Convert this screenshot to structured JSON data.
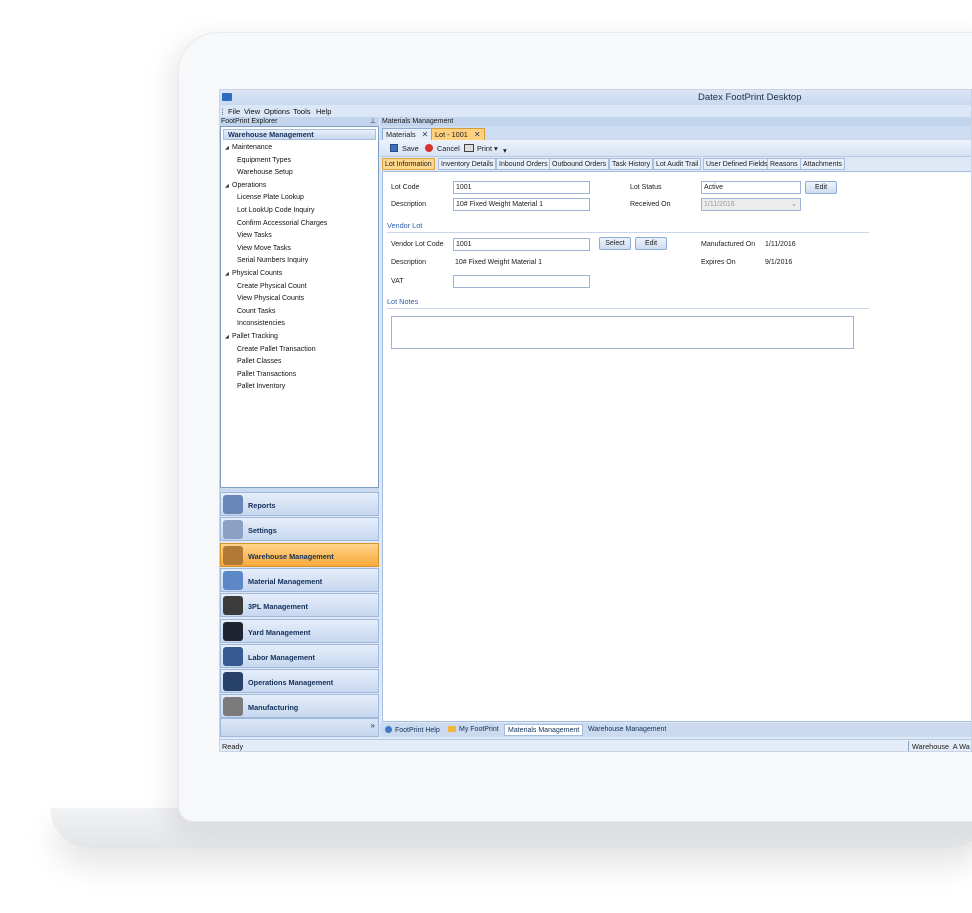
{
  "app": {
    "title": "Datex FootPrint Desktop"
  },
  "menu": [
    "File",
    "View",
    "Options",
    "Tools",
    "Help"
  ],
  "explorer": {
    "header": "FootPrint Explorer",
    "section": "Warehouse Management",
    "tree": [
      {
        "label": "Maintenance",
        "group": true
      },
      {
        "label": "Equipment Types"
      },
      {
        "label": "Warehouse Setup"
      },
      {
        "label": "Operations",
        "group": true
      },
      {
        "label": "License Plate Lookup"
      },
      {
        "label": "Lot LookUp Code Inquiry"
      },
      {
        "label": "Confirm Accessorial Charges"
      },
      {
        "label": "View Tasks"
      },
      {
        "label": "View Move Tasks"
      },
      {
        "label": "Serial Numbers Inquiry"
      },
      {
        "label": "Physical Counts",
        "group": true
      },
      {
        "label": "Create Physical Count"
      },
      {
        "label": "View Physical Counts"
      },
      {
        "label": "Count Tasks"
      },
      {
        "label": "Inconsistencies"
      },
      {
        "label": "Pallet Tracking",
        "group": true
      },
      {
        "label": "Create Pallet Transaction"
      },
      {
        "label": "Pallet Classes"
      },
      {
        "label": "Pallet Transactions"
      },
      {
        "label": "Pallet Inventory"
      }
    ]
  },
  "nav": [
    {
      "label": "Reports",
      "icon": "reports-icon",
      "color": "#6a86b8"
    },
    {
      "label": "Settings",
      "icon": "settings-icon",
      "color": "#8aa1c4"
    },
    {
      "label": "Warehouse Management",
      "icon": "warehouse-icon",
      "color": "#b07a36",
      "active": true
    },
    {
      "label": "Material Management",
      "icon": "material-icon",
      "color": "#5d88c7"
    },
    {
      "label": "3PL Management",
      "icon": "3pl-icon",
      "color": "#3b3b3b"
    },
    {
      "label": "Yard Management",
      "icon": "yard-icon",
      "color": "#1f2430"
    },
    {
      "label": "Labor Management",
      "icon": "labor-icon",
      "color": "#365b91"
    },
    {
      "label": "Operations Management",
      "icon": "operations-icon",
      "color": "#27416b"
    },
    {
      "label": "Manufacturing",
      "icon": "manufacturing-icon",
      "color": "#7b7b7b"
    }
  ],
  "main": {
    "header": "Materials Management",
    "doc_tabs": [
      {
        "label": "Materials"
      },
      {
        "label": "Lot - 1001",
        "active": true
      }
    ],
    "toolbar": {
      "save": "Save",
      "cancel": "Cancel",
      "print": "Print"
    },
    "subtabs": [
      {
        "label": "Lot Information",
        "active": true
      },
      {
        "label": "Inventory Details"
      },
      {
        "label": "Inbound Orders"
      },
      {
        "label": "Outbound Orders"
      },
      {
        "label": "Task History"
      },
      {
        "label": "Lot Audit Trail"
      },
      {
        "label": "User Defined Fields"
      },
      {
        "label": "Reasons"
      },
      {
        "label": "Attachments"
      }
    ],
    "form": {
      "lot_code_label": "Lot Code",
      "lot_code": "1001",
      "description_label": "Description",
      "description": "10# Fixed Weight Material 1",
      "lot_status_label": "Lot Status",
      "lot_status": "Active",
      "edit": "Edit",
      "received_on_label": "Received On",
      "received_on": "1/11/2016",
      "vendor_lot_section": "Vendor Lot",
      "vendor_lot_code_label": "Vendor Lot Code",
      "vendor_lot_code": "1001",
      "select": "Select",
      "vendor_description_label": "Description",
      "vendor_description": "10# Fixed Weight Material 1",
      "vat_label": "VAT",
      "vat": "",
      "manufactured_on_label": "Manufactured On",
      "manufactured_on": "1/11/2016",
      "expires_on_label": "Expires On",
      "expires_on": "9/1/2016",
      "lot_notes_section": "Lot Notes"
    },
    "bottom_tabs": [
      {
        "label": "FootPrint Help"
      },
      {
        "label": "My FootPrint"
      },
      {
        "label": "Materials Management",
        "active": true
      },
      {
        "label": "Warehouse Management"
      }
    ]
  },
  "status": {
    "left": "Ready",
    "right": "Warehouse  A Wa"
  }
}
